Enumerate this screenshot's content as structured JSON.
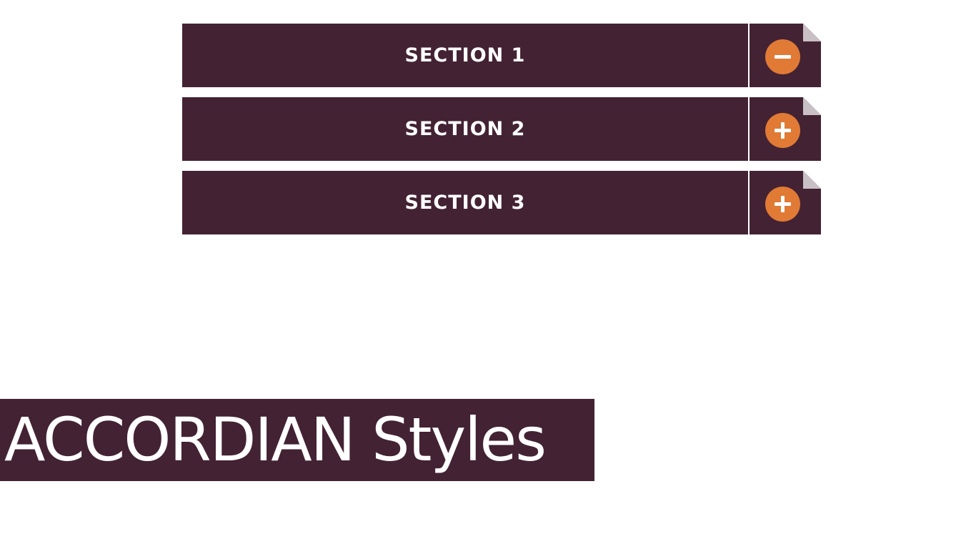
{
  "accordion": {
    "sections": [
      {
        "label": "SECTION 1",
        "state": "expanded",
        "icon": "minus-icon"
      },
      {
        "label": "SECTION 2",
        "state": "collapsed",
        "icon": "plus-icon"
      },
      {
        "label": "SECTION 3",
        "state": "collapsed",
        "icon": "plus-icon"
      }
    ]
  },
  "banner": {
    "title": "ACCORDIAN Styles"
  },
  "colors": {
    "header_bg": "#432233",
    "toggle_circle": "#e07a35",
    "text": "#ffffff",
    "page_bg": "#ffffff"
  }
}
